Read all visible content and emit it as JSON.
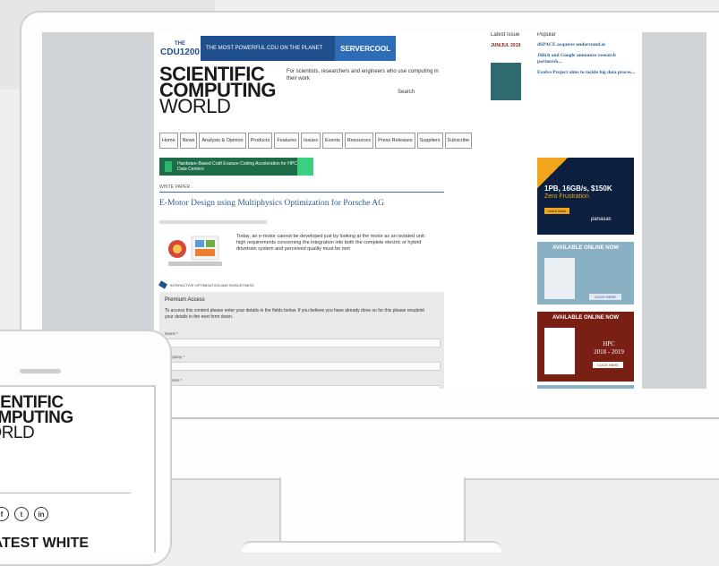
{
  "site": {
    "banner": {
      "product_small": "THE",
      "product": "CDU1200",
      "tagline": "THE MOST POWERFUL CDU ON THE PLANET",
      "brand": "SERVERCOOL"
    },
    "logo": {
      "line1": "SCIENTIFIC",
      "line2": "COMPUTING",
      "line3": "WORLD"
    },
    "tagline": "For scientists, researchers and engineers who use computing in their work",
    "search_label": "Search",
    "nav": [
      "Home",
      "News",
      "Analysis & Opinion",
      "Products",
      "Features",
      "Issues",
      "Events",
      "Resources",
      "Press Releases",
      "Suppliers",
      "Subscribe"
    ],
    "ad_green": "Hardware-Based Craft Erasure Coding Acceleration for HPC Data Centers",
    "section_label": "WHITE PAPER",
    "article_title": "E-Motor Design using Multiphysics Optimization for Porsche AG",
    "description": "Today, an e-motor cannot be developed just by looking at the motor as an isolated unit: high requirements concerning the integration into both the complete electric or hybrid drivetrain system and perceived quality must be met",
    "tab_label": "INTERACTIVE OPTIMIZATION AND ROBUSTNESS",
    "form": {
      "heading": "Premium Access",
      "paragraph": "To access this content please enter your details in the fields below. If you believe you have already done so for this please resubmit your details in the next form down.",
      "fields": [
        "Name *",
        "Company *",
        "Address *"
      ]
    },
    "latest_issue": {
      "title": "Latest Issue",
      "date": "JUN/JUL 2019"
    },
    "popular": {
      "title": "Popular",
      "items": [
        "dSPACE acquires understand.ai",
        "Jülich and Google announce research partnersh...",
        "Evolve Project aims to tackle big data proces..."
      ]
    },
    "ad1": {
      "headline": "1PB, 16GB/s, $150K",
      "sub": "Zero Frustration",
      "button": "Learn More",
      "brand": "panasas"
    },
    "ad2": {
      "title": "AVAILABLE ONLINE NOW",
      "button": "CLICK HERE"
    },
    "ad3": {
      "title": "AVAILABLE ONLINE NOW",
      "hpc": "HPC",
      "years": "2018 - 2019",
      "button": "CLICK HERE"
    }
  },
  "phone": {
    "logo": {
      "line1": "SCIENTIFIC",
      "line2": "COMPUTING",
      "line3": "WORLD"
    },
    "social": [
      "f",
      "t",
      "in"
    ],
    "heading": "LATEST WHITE"
  },
  "colors": {
    "brand_blue": "#1f4f8c",
    "link": "#2a5d92",
    "ad_red": "#7a1f14",
    "ad_navy": "#0d1f3f"
  }
}
